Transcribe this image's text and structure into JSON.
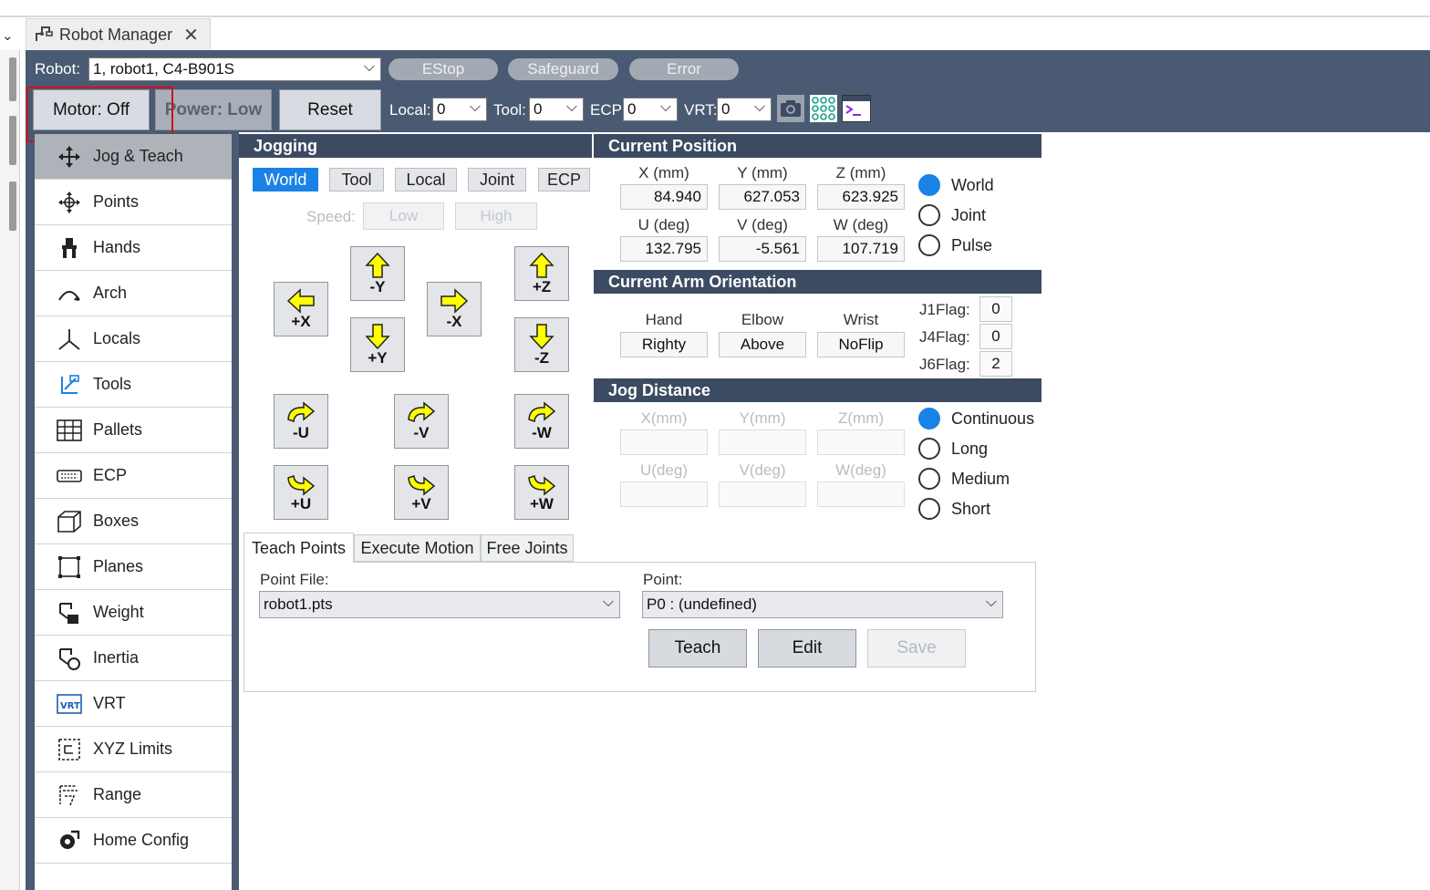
{
  "window": {
    "tab_title": "Robot Manager",
    "close": "✕"
  },
  "header": {
    "robot_label": "Robot:",
    "robot_value": "1, robot1, C4-B901S",
    "estop": "EStop",
    "safeguard": "Safeguard",
    "error": "Error",
    "motor_button": "Motor: Off",
    "power_button": "Power: Low",
    "reset_button": "Reset",
    "local_label": "Local:",
    "local_value": "0",
    "tool_label": "Tool:",
    "tool_value": "0",
    "ecp_label": "ECP:",
    "ecp_value": "0",
    "vrt_label": "VRT:",
    "vrt_value": "0"
  },
  "sidebar": {
    "items": [
      {
        "label": "Jog & Teach",
        "icon": "jog-move-icon",
        "active": true
      },
      {
        "label": "Points",
        "icon": "points-icon"
      },
      {
        "label": "Hands",
        "icon": "hand-icon"
      },
      {
        "label": "Arch",
        "icon": "arch-icon"
      },
      {
        "label": "Locals",
        "icon": "locals-axes-icon"
      },
      {
        "label": "Tools",
        "icon": "tools-icon"
      },
      {
        "label": "Pallets",
        "icon": "pallet-grid-icon"
      },
      {
        "label": "ECP",
        "icon": "ecp-icon"
      },
      {
        "label": "Boxes",
        "icon": "box-icon"
      },
      {
        "label": "Planes",
        "icon": "plane-icon"
      },
      {
        "label": "Weight",
        "icon": "weight-icon"
      },
      {
        "label": "Inertia",
        "icon": "inertia-icon"
      },
      {
        "label": "VRT",
        "icon": "vrt-icon"
      },
      {
        "label": "XYZ Limits",
        "icon": "xyz-limits-icon"
      },
      {
        "label": "Range",
        "icon": "range-icon"
      },
      {
        "label": "Home Config",
        "icon": "home-config-icon"
      }
    ]
  },
  "jogging": {
    "title": "Jogging",
    "frames": [
      "World",
      "Tool",
      "Local",
      "Joint",
      "ECP"
    ],
    "selected_frame": "World",
    "speed_label": "Speed:",
    "speed_low": "Low",
    "speed_high": "High",
    "buttons": {
      "minus_y": "-Y",
      "plus_z": "+Z",
      "plus_x": "+X",
      "minus_x": "-X",
      "plus_y": "+Y",
      "minus_z": "-Z",
      "minus_u": "-U",
      "minus_v": "-V",
      "minus_w": "-W",
      "plus_u": "+U",
      "plus_v": "+V",
      "plus_w": "+W"
    }
  },
  "current_position": {
    "title": "Current Position",
    "labels": [
      "X (mm)",
      "Y (mm)",
      "Z (mm)",
      "U (deg)",
      "V (deg)",
      "W (deg)"
    ],
    "values": [
      "84.940",
      "627.053",
      "623.925",
      "132.795",
      "-5.561",
      "107.719"
    ],
    "modes": [
      "World",
      "Joint",
      "Pulse"
    ],
    "selected_mode": "World"
  },
  "arm_orientation": {
    "title": "Current Arm Orientation",
    "hand_label": "Hand",
    "hand_value": "Righty",
    "elbow_label": "Elbow",
    "elbow_value": "Above",
    "wrist_label": "Wrist",
    "wrist_value": "NoFlip",
    "j1flag_label": "J1Flag:",
    "j1flag_value": "0",
    "j4flag_label": "J4Flag:",
    "j4flag_value": "0",
    "j6flag_label": "J6Flag:",
    "j6flag_value": "2"
  },
  "jog_distance": {
    "title": "Jog Distance",
    "labels": [
      "X(mm)",
      "Y(mm)",
      "Z(mm)",
      "U(deg)",
      "V(deg)",
      "W(deg)"
    ],
    "modes": [
      "Continuous",
      "Long",
      "Medium",
      "Short"
    ],
    "selected_mode": "Continuous"
  },
  "tabs": [
    "Teach Points",
    "Execute Motion",
    "Free Joints"
  ],
  "teach": {
    "point_file_label": "Point File:",
    "point_file_value": "robot1.pts",
    "point_label": "Point:",
    "point_value": "P0 : (undefined)",
    "teach_button": "Teach",
    "edit_button": "Edit",
    "save_button": "Save"
  },
  "colors": {
    "accent": "#1a82e6",
    "frame": "#4a5a73",
    "section": "#3c4a62",
    "highlight_box": "#d0131a",
    "arrow": "#ffff00"
  }
}
